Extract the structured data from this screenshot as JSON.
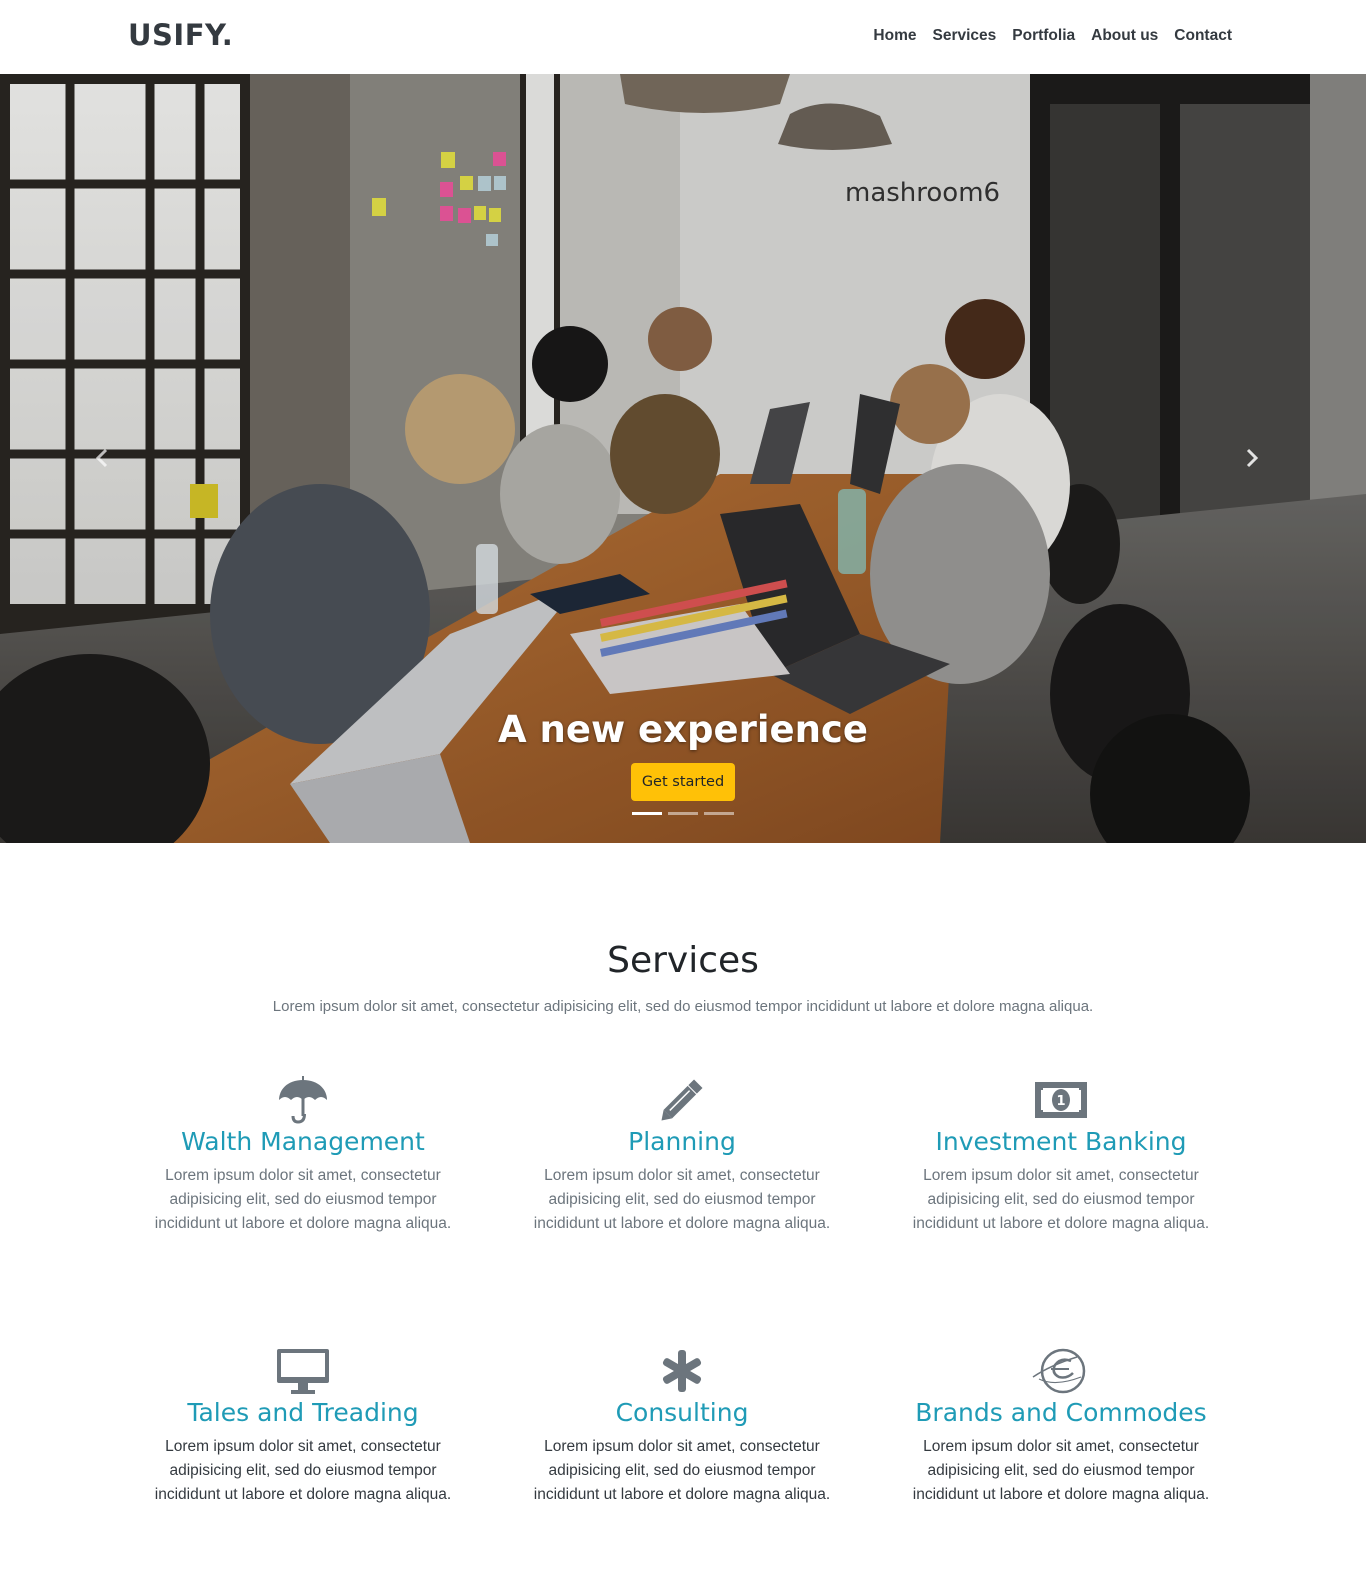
{
  "navbar": {
    "brand": "USIFY.",
    "links": [
      "Home",
      "Services",
      "Portfolia",
      "About us",
      "Contact"
    ]
  },
  "hero": {
    "title": "A new experience",
    "button_label": "Get started",
    "wall_sign": "mashroom6",
    "slide_count": 3,
    "active_slide": 1
  },
  "services": {
    "title": "Services",
    "subtitle": "Lorem ipsum dolor sit amet, consectetur adipisicing elit, sed do eiusmod tempor incididunt ut labore et dolore magna aliqua.",
    "items": [
      {
        "icon": "umbrella-icon",
        "title": "Walth Management",
        "text": "Lorem ipsum dolor sit amet, consectetur adipisicing elit, sed do eiusmod tempor incididunt ut labore et dolore magna aliqua."
      },
      {
        "icon": "pencil-icon",
        "title": "Planning",
        "text": "Lorem ipsum dolor sit amet, consectetur adipisicing elit, sed do eiusmod tempor incididunt ut labore et dolore magna aliqua."
      },
      {
        "icon": "money-bill-icon",
        "title": "Investment Banking",
        "text": "Lorem ipsum dolor sit amet, consectetur adipisicing elit, sed do eiusmod tempor incididunt ut labore et dolore magna aliqua."
      },
      {
        "icon": "monitor-icon",
        "title": "Tales and Treading",
        "text": "Lorem ipsum dolor sit amet, consectetur adipisicing elit, sed do eiusmod tempor incididunt ut labore et dolore magna aliqua."
      },
      {
        "icon": "asterisk-icon",
        "title": "Consulting",
        "text": "Lorem ipsum dolor sit amet, consectetur adipisicing elit, sed do eiusmod tempor incididunt ut labore et dolore magna aliqua."
      },
      {
        "icon": "globe-orbit-icon",
        "title": "Brands and Commodes",
        "text": "Lorem ipsum dolor sit amet, consectetur adipisicing elit, sed do eiusmod tempor incididunt ut labore et dolore magna aliqua."
      }
    ]
  },
  "colors": {
    "accent": "#1f9bb6",
    "button": "#ffc107",
    "icon": "#6c757d",
    "brand_text": "#343a40"
  }
}
